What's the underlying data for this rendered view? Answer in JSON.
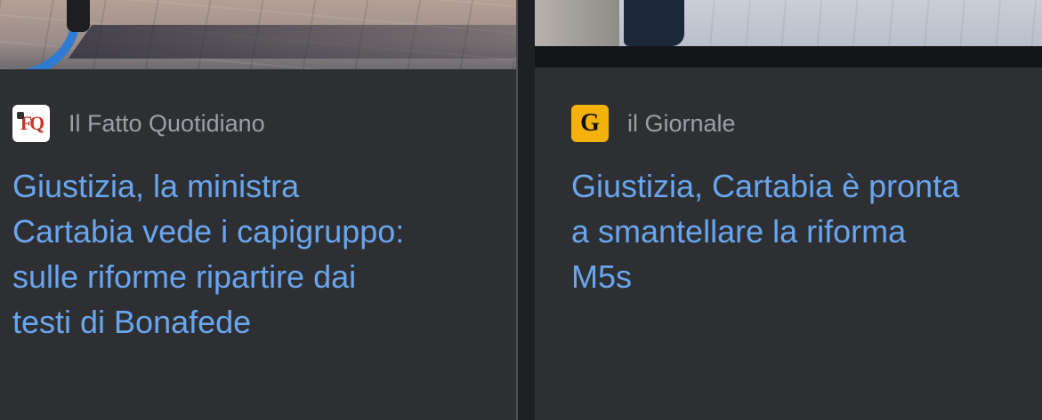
{
  "articles": [
    {
      "source": "Il Fatto Quotidiano",
      "logo_text": "FQ",
      "logo_icon": "fatto-quotidiano-logo-icon",
      "headline": "Giustizia, la ministra\nCartabia vede i capigruppo:\nsulle riforme ripartire dai\ntesti di Bonafede"
    },
    {
      "source": "il Giornale",
      "logo_text": "G",
      "logo_icon": "il-giornale-logo-icon",
      "headline": "Giustizia, Cartabia è pronta\na smantellare la riforma\nM5s"
    }
  ],
  "colors": {
    "background": "#1f2023",
    "card": "#2e2f33",
    "headline": "#69a6ee",
    "source": "#9aa0a6",
    "giornale_logo": "#f5b20a"
  }
}
